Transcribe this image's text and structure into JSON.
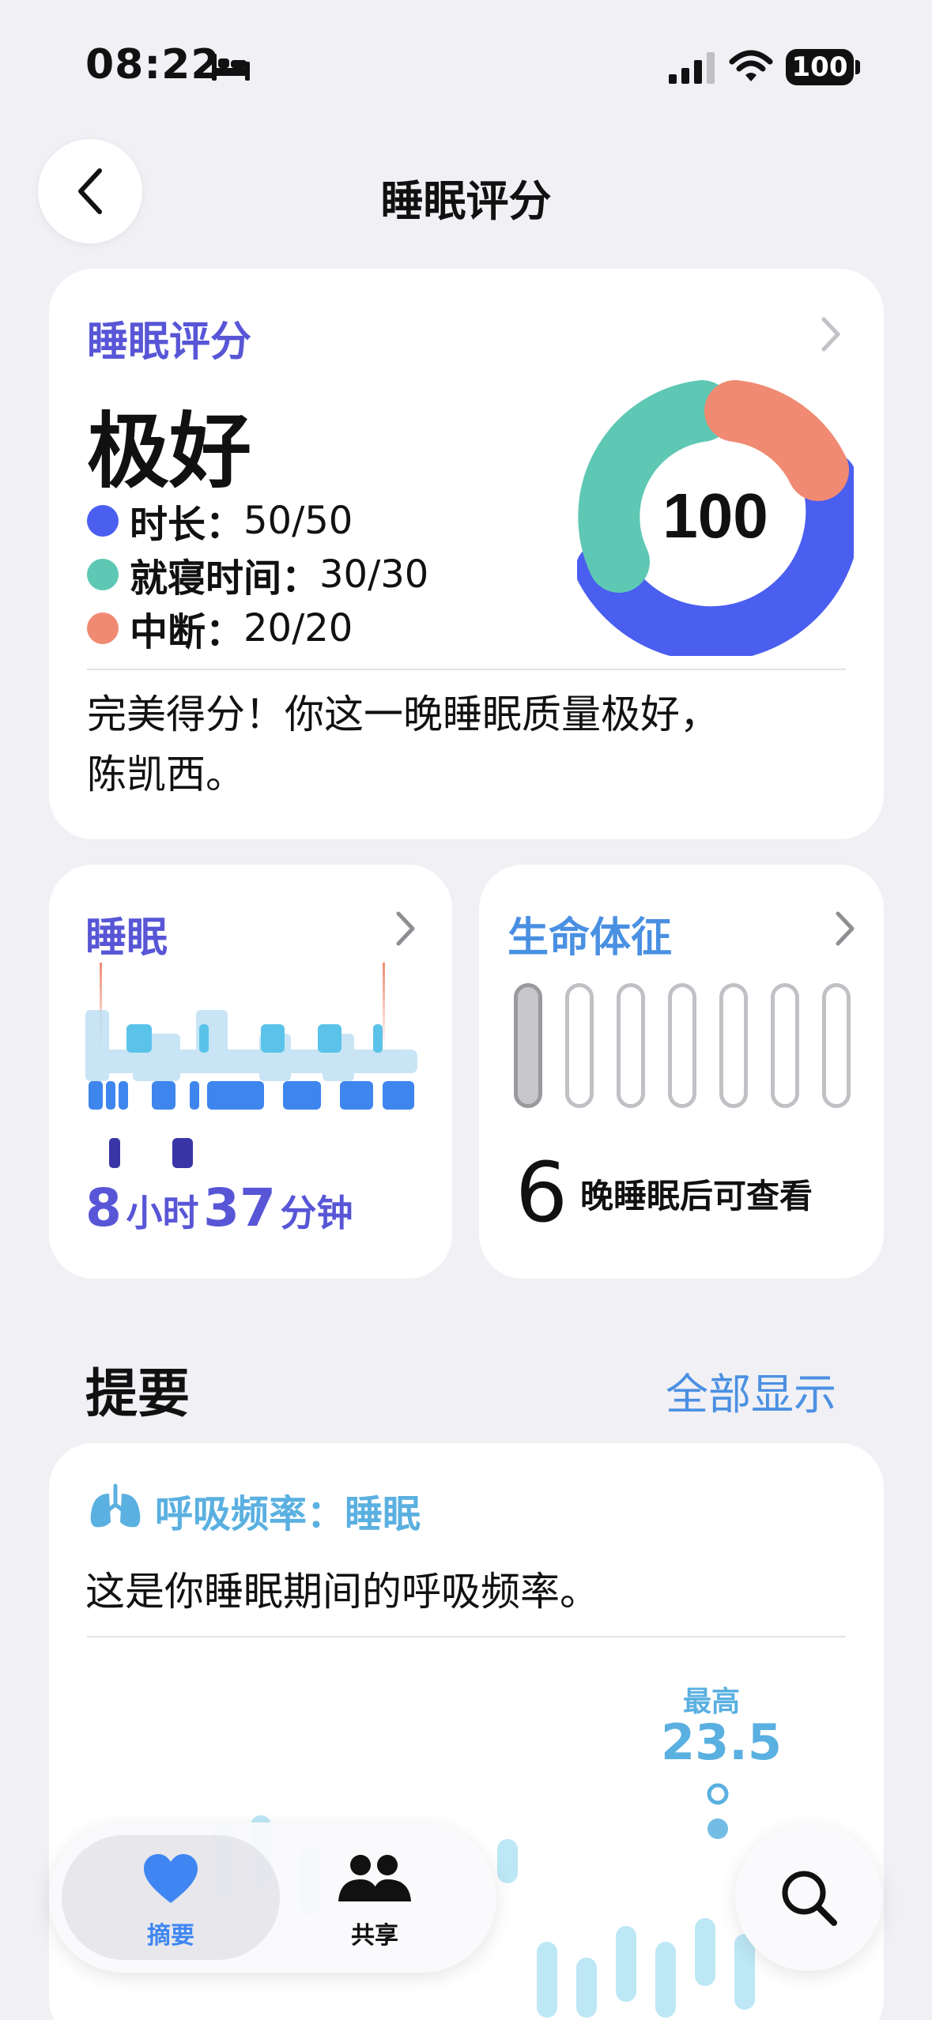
{
  "status_bar": {
    "time": "08:22",
    "battery": "100"
  },
  "nav": {
    "title": "睡眠评分"
  },
  "score_card": {
    "label": "睡眠评分",
    "rating": "极好",
    "score": "100",
    "legend": [
      {
        "label": "时长：",
        "value": "50/50",
        "color": "#4a5ef0"
      },
      {
        "label": "就寝时间：",
        "value": "30/30",
        "color": "#5ec8b4"
      },
      {
        "label": "中断：",
        "value": "20/20",
        "color": "#f08a72"
      }
    ],
    "message_line1": "完美得分！你这一晚睡眠质量极好，",
    "message_line2": "陈凯西。"
  },
  "sleep_card": {
    "label": "睡眠",
    "hours": "8",
    "hours_unit": "小时",
    "minutes": "37",
    "minutes_unit": "分钟"
  },
  "vitals_card": {
    "label": "生命体征",
    "nights": "6",
    "nights_text": "晚睡眠后可查看",
    "filled_nights": 1,
    "total_nights": 7
  },
  "highlights": {
    "title": "提要",
    "show_all": "全部显示",
    "card_label": "呼吸频率：睡眠",
    "description": "这是你睡眠期间的呼吸频率。",
    "max_label": "最高",
    "max_value": "23.5"
  },
  "tabbar": {
    "tabs": [
      {
        "label": "摘要",
        "icon": "heart-icon",
        "active": true
      },
      {
        "label": "共享",
        "icon": "people-icon",
        "active": false
      }
    ]
  },
  "colors": {
    "accent_purple": "#5856d6",
    "accent_blue": "#4a90e2",
    "duration": "#4a5ef0",
    "bedtime": "#5ec8b4",
    "interruptions": "#f08a72"
  }
}
